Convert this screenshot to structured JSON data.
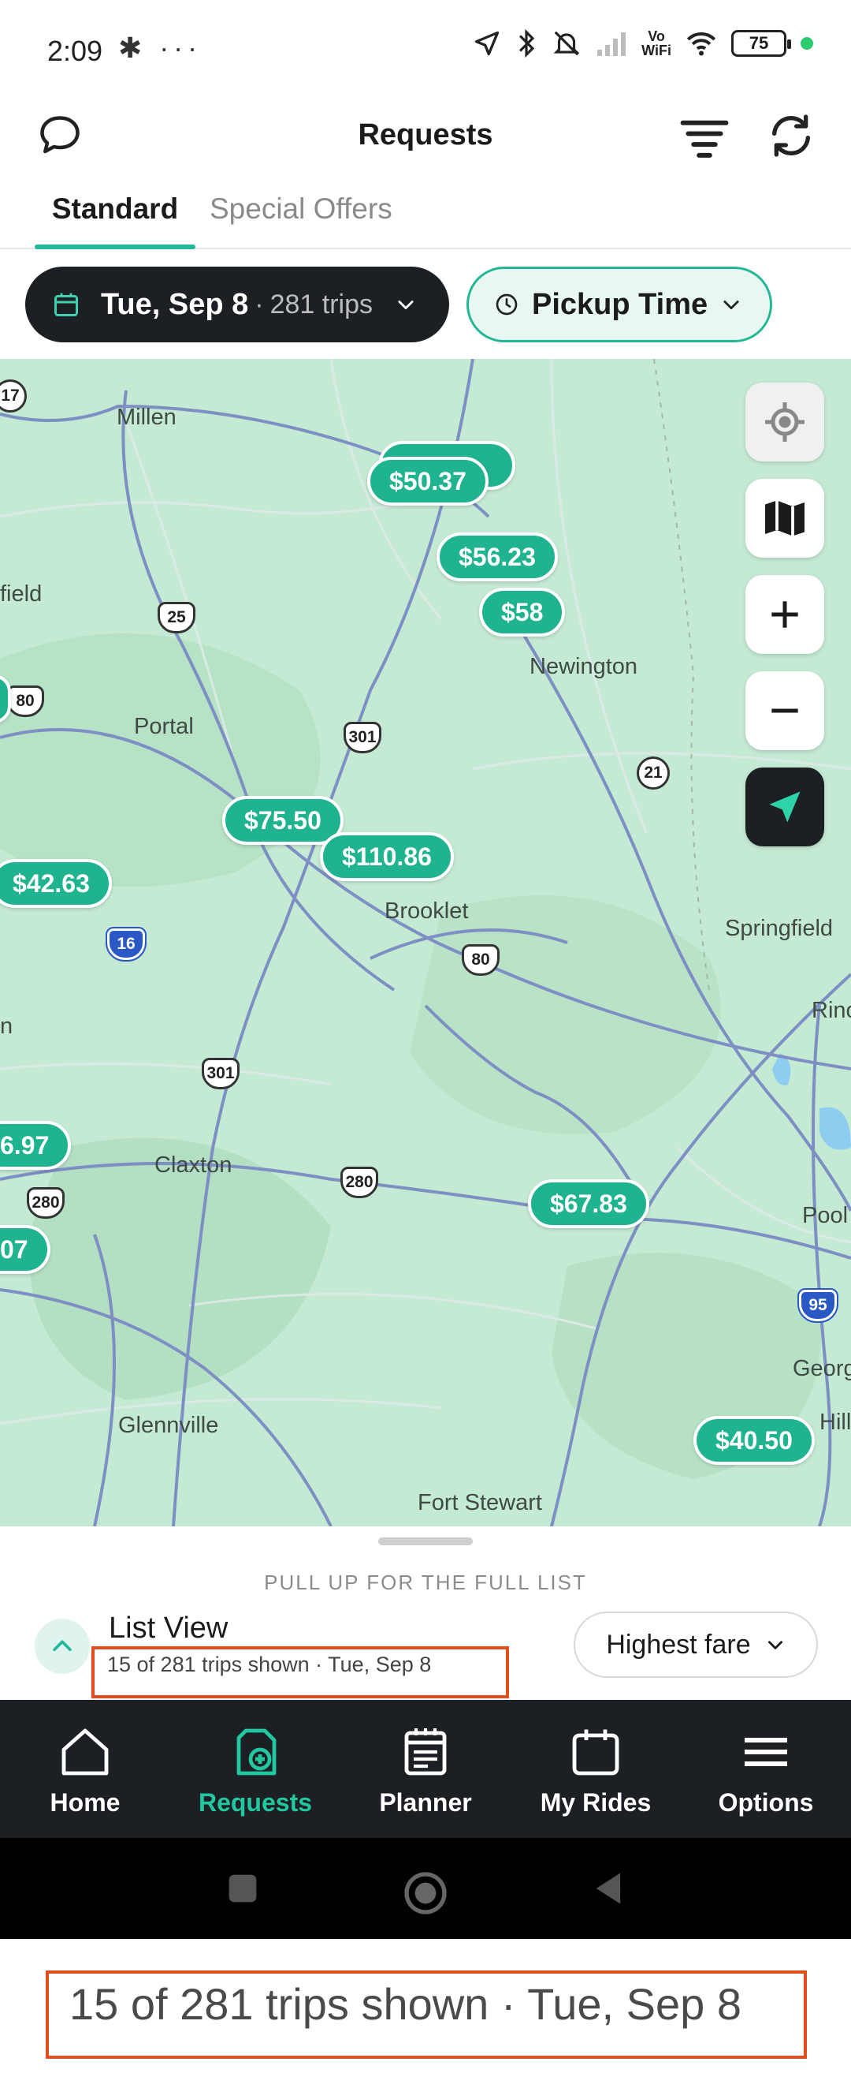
{
  "status_bar": {
    "time": "2:09",
    "left_icons": [
      "slack-icon",
      "more-dots-icon"
    ],
    "right_icons": [
      "navigation-icon",
      "bluetooth-icon",
      "mute-icon",
      "signal-icon",
      "vowifi-icon",
      "wifi-icon"
    ],
    "vowifi_top": "Vo",
    "vowifi_bottom": "WiFi",
    "battery": "75"
  },
  "header": {
    "title": "Requests"
  },
  "tabs": [
    {
      "label": "Standard",
      "active": true
    },
    {
      "label": "Special Offers",
      "active": false
    }
  ],
  "filters": {
    "date_label": "Tue, Sep 8",
    "date_separator": "·",
    "trips_label": "281 trips",
    "pickup_label": "Pickup Time"
  },
  "map": {
    "towns": [
      "Millen",
      "field",
      "Portal",
      "Newington",
      "Brooklet",
      "Springfield",
      "Rinc",
      "n",
      "Claxton",
      "Pool",
      "Georg",
      "Hill",
      "Glennville",
      "Fort Stewart"
    ],
    "routes": [
      "17",
      "25",
      "80",
      "301",
      "21",
      "16",
      "80",
      "301",
      "280",
      "280",
      "95"
    ],
    "fares": [
      "$50.37",
      "$56.23",
      "$58",
      "$75.50",
      "$110.86",
      "$42.63",
      "6.97",
      "07",
      "$67.83",
      "$40.50"
    ]
  },
  "sheet": {
    "hint": "PULL UP FOR THE FULL LIST",
    "list_title": "List View",
    "list_subtitle": "15 of 281 trips shown · Tue, Sep 8",
    "sort_label": "Highest fare"
  },
  "nav": [
    {
      "label": "Home",
      "icon": "home-icon"
    },
    {
      "label": "Requests",
      "icon": "requests-icon",
      "active": true
    },
    {
      "label": "Planner",
      "icon": "planner-icon"
    },
    {
      "label": "My Rides",
      "icon": "calendar-icon"
    },
    {
      "label": "Options",
      "icon": "menu-icon"
    }
  ],
  "zoom_caption": "15 of 281 trips shown · Tue, Sep 8",
  "colors": {
    "accent": "#1fb99a",
    "dark": "#1c1f23",
    "highlight": "#e0501f"
  }
}
